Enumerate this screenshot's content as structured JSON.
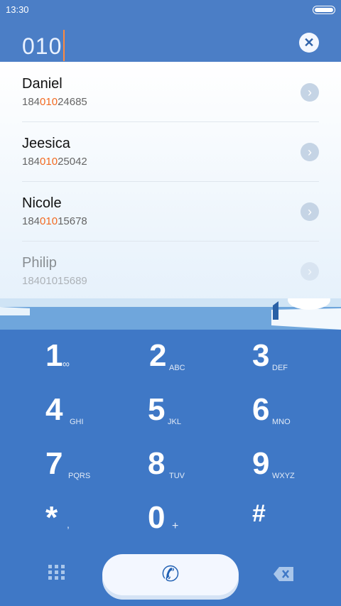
{
  "status": {
    "time": "13:30"
  },
  "input": {
    "digits": "010"
  },
  "contacts": [
    {
      "name": "Daniel",
      "pre": "184",
      "hl": "010",
      "post": "24685"
    },
    {
      "name": "Jeesica",
      "pre": "184",
      "hl": "010",
      "post": "25042"
    },
    {
      "name": "Nicole",
      "pre": "184",
      "hl": "010",
      "post": "15678"
    },
    {
      "name": "Philip",
      "pre": "18401015689",
      "hl": "",
      "post": ""
    }
  ],
  "keys": [
    {
      "digit": "1",
      "letters": "∞"
    },
    {
      "digit": "2",
      "letters": "ABC"
    },
    {
      "digit": "3",
      "letters": "DEF"
    },
    {
      "digit": "4",
      "letters": "GHI"
    },
    {
      "digit": "5",
      "letters": "JKL"
    },
    {
      "digit": "6",
      "letters": "MNO"
    },
    {
      "digit": "7",
      "letters": "PQRS"
    },
    {
      "digit": "8",
      "letters": "TUV"
    },
    {
      "digit": "9",
      "letters": "WXYZ"
    },
    {
      "digit": "*",
      "letters": ","
    },
    {
      "digit": "0",
      "letters": "+"
    },
    {
      "digit": "#",
      "letters": ""
    }
  ],
  "icons": {
    "clear": "close-icon",
    "chevron": "chevron-right-icon",
    "call": "phone-icon",
    "dialpad": "dialpad-icon",
    "backspace": "backspace-icon"
  }
}
